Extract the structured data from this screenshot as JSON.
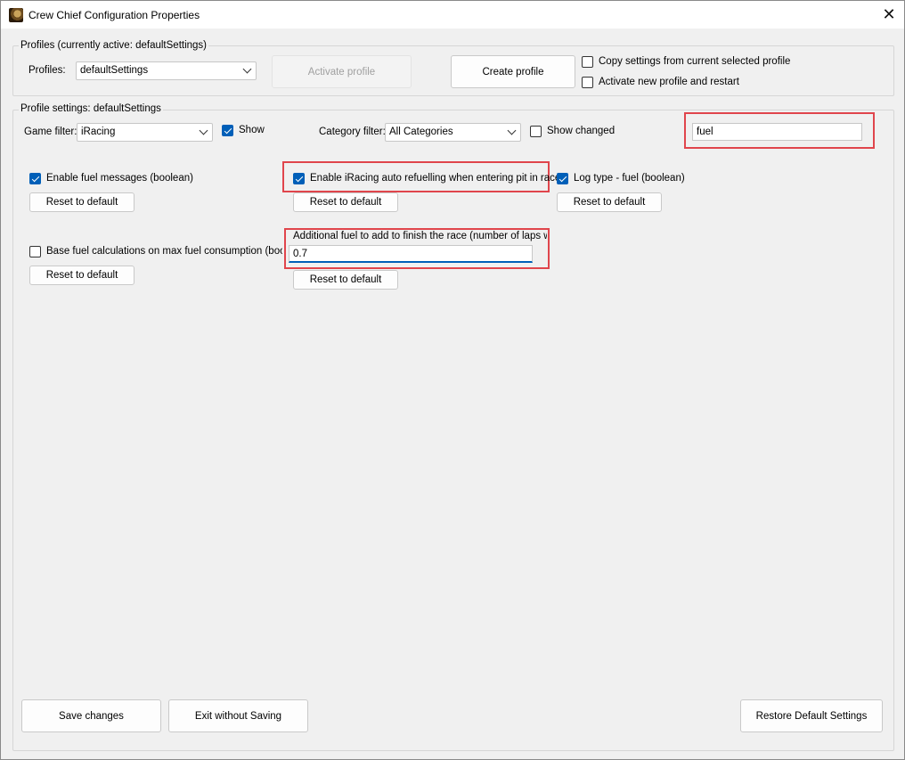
{
  "window": {
    "title": "Crew Chief Configuration Properties",
    "close_glyph": "✕"
  },
  "profiles": {
    "group_label": "Profiles (currently active: defaultSettings)",
    "profiles_label": "Profiles:",
    "selected": "defaultSettings",
    "activate_label": "Activate profile",
    "create_label": "Create profile",
    "copy_label": "Copy settings from current selected profile",
    "copy_checked": false,
    "activate_restart_label": "Activate new profile and restart",
    "activate_restart_checked": false
  },
  "settings": {
    "group_label": "Profile settings: defaultSettings",
    "game_filter_label": "Game filter:",
    "game_filter_value": "iRacing",
    "show_label": "Show",
    "show_checked": true,
    "category_filter_label": "Category filter:",
    "category_filter_value": "All Categories",
    "show_changed_label": "Show changed",
    "show_changed_checked": false,
    "search_value": "fuel"
  },
  "items": {
    "enable_fuel_label": "Enable fuel messages (boolean)",
    "enable_fuel_checked": true,
    "auto_refuel_label": "Enable iRacing auto refuelling when entering pit in race",
    "auto_refuel_checked": true,
    "log_type_label": "Log type - fuel (boolean)",
    "log_type_checked": true,
    "base_fuel_label": "Base fuel calculations on max fuel consumption (boolear",
    "base_fuel_checked": false,
    "additional_fuel_label": "Additional fuel to add to finish the race (number of laps worth",
    "additional_fuel_value": "0.7",
    "reset_label": "Reset to default"
  },
  "footer": {
    "save_label": "Save changes",
    "exit_label": "Exit without Saving",
    "restore_label": "Restore Default Settings"
  },
  "colors": {
    "accent": "#005fb8",
    "highlight": "#e0454c"
  }
}
